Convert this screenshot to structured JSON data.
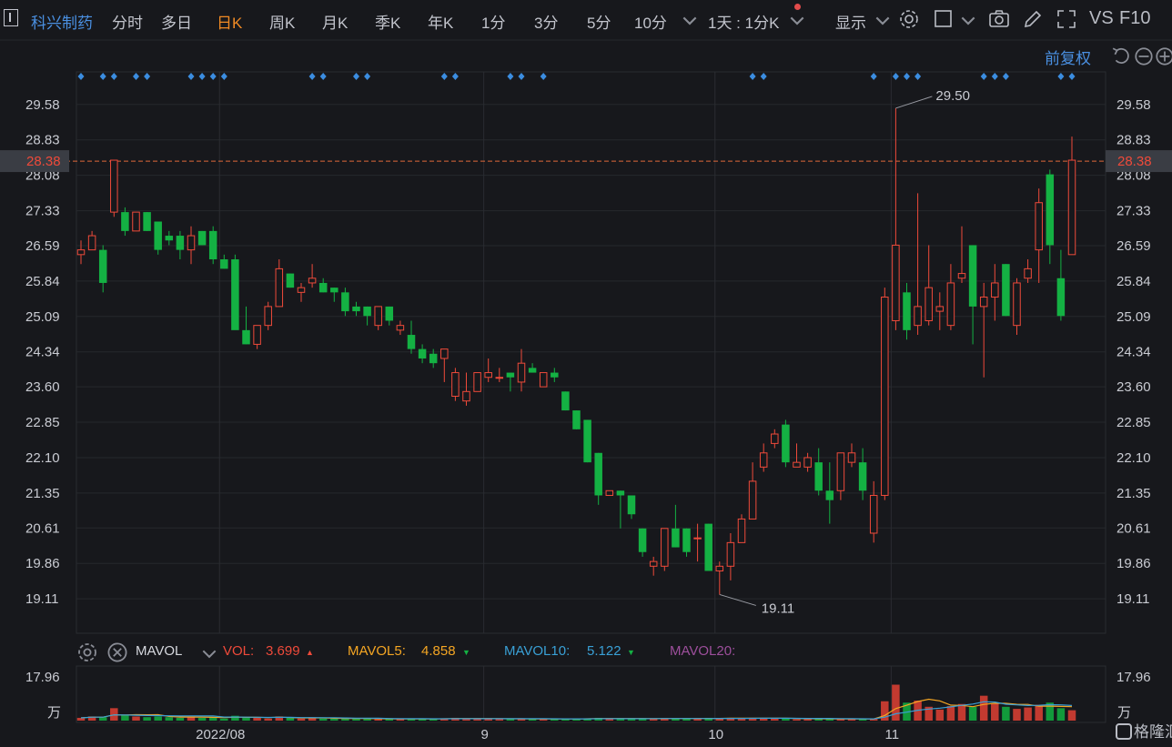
{
  "toolbar": {
    "stock_name": "科兴制药",
    "tabs": [
      "分时",
      "多日",
      "日K",
      "周K",
      "月K",
      "季K",
      "年K",
      "1分",
      "3分",
      "5分",
      "10分"
    ],
    "active_tab": "日K",
    "interval_select": "1天 : 1分K",
    "display_label": "显示",
    "vs_label": "VS",
    "f10_label": "F10",
    "adjust_label": "前复权"
  },
  "chart_data": {
    "type": "candlestick",
    "price_ticks": [
      "29.58",
      "28.83",
      "28.08",
      "27.33",
      "26.59",
      "25.84",
      "25.09",
      "24.34",
      "23.60",
      "22.85",
      "22.10",
      "21.35",
      "20.61",
      "19.86",
      "19.11"
    ],
    "ylim": [
      18.38,
      30.27
    ],
    "current_price": "28.38",
    "high_label": "29.50",
    "low_label": "19.11",
    "date_labels": [
      "2022/08",
      "9",
      "10",
      "11"
    ],
    "candles": [
      {
        "o": 26.4,
        "h": 26.7,
        "l": 26.2,
        "c": 26.5
      },
      {
        "o": 26.5,
        "h": 26.9,
        "l": 26.5,
        "c": 26.8
      },
      {
        "o": 26.5,
        "h": 26.6,
        "l": 25.6,
        "c": 25.8
      },
      {
        "o": 27.3,
        "h": 28.4,
        "l": 27.2,
        "c": 28.4
      },
      {
        "o": 27.3,
        "h": 27.4,
        "l": 26.8,
        "c": 26.9
      },
      {
        "o": 26.9,
        "h": 27.3,
        "l": 26.9,
        "c": 27.3
      },
      {
        "o": 27.3,
        "h": 27.3,
        "l": 26.9,
        "c": 26.9
      },
      {
        "o": 27.1,
        "h": 27.1,
        "l": 26.4,
        "c": 26.5
      },
      {
        "o": 26.8,
        "h": 26.9,
        "l": 26.6,
        "c": 26.7
      },
      {
        "o": 26.8,
        "h": 26.9,
        "l": 26.3,
        "c": 26.5
      },
      {
        "o": 26.5,
        "h": 27.0,
        "l": 26.2,
        "c": 26.8
      },
      {
        "o": 26.9,
        "h": 26.9,
        "l": 26.6,
        "c": 26.6
      },
      {
        "o": 26.9,
        "h": 27.0,
        "l": 26.2,
        "c": 26.3
      },
      {
        "o": 26.3,
        "h": 26.4,
        "l": 26.1,
        "c": 26.1
      },
      {
        "o": 26.3,
        "h": 26.4,
        "l": 24.9,
        "c": 24.8
      },
      {
        "o": 24.8,
        "h": 25.3,
        "l": 24.5,
        "c": 24.5
      },
      {
        "o": 24.5,
        "h": 24.9,
        "l": 24.4,
        "c": 24.9
      },
      {
        "o": 24.9,
        "h": 25.4,
        "l": 24.8,
        "c": 25.3
      },
      {
        "o": 25.3,
        "h": 26.3,
        "l": 25.3,
        "c": 26.1
      },
      {
        "o": 26.0,
        "h": 26.0,
        "l": 25.7,
        "c": 25.7
      },
      {
        "o": 25.6,
        "h": 25.8,
        "l": 25.4,
        "c": 25.7
      },
      {
        "o": 25.8,
        "h": 26.2,
        "l": 25.7,
        "c": 25.9
      },
      {
        "o": 25.8,
        "h": 25.9,
        "l": 25.6,
        "c": 25.6
      },
      {
        "o": 25.7,
        "h": 25.7,
        "l": 25.4,
        "c": 25.6
      },
      {
        "o": 25.6,
        "h": 25.7,
        "l": 25.1,
        "c": 25.2
      },
      {
        "o": 25.3,
        "h": 25.4,
        "l": 25.1,
        "c": 25.2
      },
      {
        "o": 25.3,
        "h": 25.3,
        "l": 24.9,
        "c": 25.1
      },
      {
        "o": 24.9,
        "h": 25.3,
        "l": 24.8,
        "c": 25.3
      },
      {
        "o": 25.3,
        "h": 25.3,
        "l": 24.9,
        "c": 25.0
      },
      {
        "o": 24.8,
        "h": 25.0,
        "l": 24.7,
        "c": 24.9
      },
      {
        "o": 24.7,
        "h": 25.0,
        "l": 24.3,
        "c": 24.4
      },
      {
        "o": 24.4,
        "h": 24.5,
        "l": 24.1,
        "c": 24.2
      },
      {
        "o": 24.3,
        "h": 24.4,
        "l": 24.0,
        "c": 24.1
      },
      {
        "o": 24.2,
        "h": 24.4,
        "l": 23.7,
        "c": 24.4
      },
      {
        "o": 23.4,
        "h": 24.0,
        "l": 23.3,
        "c": 23.9
      },
      {
        "o": 23.3,
        "h": 23.9,
        "l": 23.2,
        "c": 23.5
      },
      {
        "o": 23.5,
        "h": 23.9,
        "l": 23.5,
        "c": 23.9
      },
      {
        "o": 23.8,
        "h": 24.2,
        "l": 23.7,
        "c": 23.9
      },
      {
        "o": 23.8,
        "h": 24.0,
        "l": 23.7,
        "c": 23.8
      },
      {
        "o": 23.9,
        "h": 23.9,
        "l": 23.5,
        "c": 23.8
      },
      {
        "o": 23.7,
        "h": 24.4,
        "l": 23.5,
        "c": 24.1
      },
      {
        "o": 24.0,
        "h": 24.1,
        "l": 23.9,
        "c": 23.9
      },
      {
        "o": 23.6,
        "h": 23.9,
        "l": 23.6,
        "c": 23.9
      },
      {
        "o": 23.9,
        "h": 24.0,
        "l": 23.7,
        "c": 23.8
      },
      {
        "o": 23.5,
        "h": 23.5,
        "l": 23.1,
        "c": 23.1
      },
      {
        "o": 23.1,
        "h": 23.1,
        "l": 22.7,
        "c": 22.7
      },
      {
        "o": 22.9,
        "h": 22.9,
        "l": 22.0,
        "c": 22.0
      },
      {
        "o": 22.2,
        "h": 22.2,
        "l": 21.1,
        "c": 21.3
      },
      {
        "o": 21.3,
        "h": 21.4,
        "l": 21.3,
        "c": 21.4
      },
      {
        "o": 21.4,
        "h": 21.4,
        "l": 20.6,
        "c": 21.3
      },
      {
        "o": 21.3,
        "h": 21.3,
        "l": 20.8,
        "c": 20.9
      },
      {
        "o": 20.6,
        "h": 20.6,
        "l": 20.0,
        "c": 20.1
      },
      {
        "o": 19.8,
        "h": 20.0,
        "l": 19.6,
        "c": 19.9
      },
      {
        "o": 19.8,
        "h": 20.6,
        "l": 19.7,
        "c": 20.6
      },
      {
        "o": 20.6,
        "h": 21.1,
        "l": 20.2,
        "c": 20.2
      },
      {
        "o": 20.6,
        "h": 20.6,
        "l": 20.0,
        "c": 20.1
      },
      {
        "o": 20.4,
        "h": 20.7,
        "l": 19.9,
        "c": 20.4
      },
      {
        "o": 20.7,
        "h": 20.7,
        "l": 19.7,
        "c": 19.7
      },
      {
        "o": 19.7,
        "h": 19.9,
        "l": 19.2,
        "c": 19.8
      },
      {
        "o": 19.8,
        "h": 20.5,
        "l": 19.5,
        "c": 20.3
      },
      {
        "o": 20.3,
        "h": 20.9,
        "l": 20.3,
        "c": 20.8
      },
      {
        "o": 20.8,
        "h": 22.0,
        "l": 20.8,
        "c": 21.6
      },
      {
        "o": 21.9,
        "h": 22.4,
        "l": 21.8,
        "c": 22.2
      },
      {
        "o": 22.4,
        "h": 22.7,
        "l": 22.3,
        "c": 22.6
      },
      {
        "o": 22.8,
        "h": 22.9,
        "l": 21.9,
        "c": 22.0
      },
      {
        "o": 21.9,
        "h": 22.4,
        "l": 21.9,
        "c": 22.0
      },
      {
        "o": 21.9,
        "h": 22.2,
        "l": 21.8,
        "c": 22.1
      },
      {
        "o": 22.0,
        "h": 22.3,
        "l": 21.3,
        "c": 21.4
      },
      {
        "o": 21.4,
        "h": 22.0,
        "l": 20.7,
        "c": 21.2
      },
      {
        "o": 21.4,
        "h": 22.2,
        "l": 21.2,
        "c": 22.2
      },
      {
        "o": 22.0,
        "h": 22.4,
        "l": 21.9,
        "c": 22.2
      },
      {
        "o": 22.0,
        "h": 22.3,
        "l": 21.2,
        "c": 21.4
      },
      {
        "o": 20.5,
        "h": 21.6,
        "l": 20.3,
        "c": 21.3
      },
      {
        "o": 21.3,
        "h": 25.7,
        "l": 21.2,
        "c": 25.5
      },
      {
        "o": 25.0,
        "h": 29.5,
        "l": 24.8,
        "c": 26.6
      },
      {
        "o": 25.6,
        "h": 25.8,
        "l": 24.6,
        "c": 24.8
      },
      {
        "o": 24.9,
        "h": 27.7,
        "l": 24.7,
        "c": 25.3
      },
      {
        "o": 25.0,
        "h": 26.6,
        "l": 24.9,
        "c": 25.7
      },
      {
        "o": 25.2,
        "h": 25.6,
        "l": 24.8,
        "c": 25.3
      },
      {
        "o": 24.9,
        "h": 26.2,
        "l": 24.8,
        "c": 25.8
      },
      {
        "o": 25.9,
        "h": 27.0,
        "l": 25.8,
        "c": 26.0
      },
      {
        "o": 26.6,
        "h": 26.6,
        "l": 24.5,
        "c": 25.3
      },
      {
        "o": 25.3,
        "h": 25.8,
        "l": 23.8,
        "c": 25.5
      },
      {
        "o": 25.5,
        "h": 26.2,
        "l": 25.0,
        "c": 25.8
      },
      {
        "o": 26.2,
        "h": 26.2,
        "l": 25.1,
        "c": 25.1
      },
      {
        "o": 24.9,
        "h": 25.9,
        "l": 24.7,
        "c": 25.8
      },
      {
        "o": 25.9,
        "h": 26.3,
        "l": 25.8,
        "c": 26.1
      },
      {
        "o": 26.5,
        "h": 27.8,
        "l": 25.8,
        "c": 27.5
      },
      {
        "o": 28.1,
        "h": 28.2,
        "l": 26.2,
        "c": 26.6
      },
      {
        "o": 25.9,
        "h": 26.5,
        "l": 25.0,
        "c": 25.1
      },
      {
        "o": 26.4,
        "h": 28.9,
        "l": 26.4,
        "c": 28.4
      }
    ],
    "markers": [
      0,
      2,
      3,
      5,
      6,
      10,
      11,
      12,
      13,
      21,
      22,
      25,
      26,
      33,
      34,
      39,
      40,
      42,
      61,
      62,
      72,
      74,
      75,
      76,
      82,
      83,
      84,
      89,
      90
    ],
    "volumes": [
      0.4,
      0.6,
      0.5,
      1.8,
      0.8,
      0.6,
      0.5,
      0.6,
      0.5,
      0.4,
      0.6,
      0.4,
      0.5,
      0.3,
      0.7,
      0.5,
      0.4,
      0.3,
      0.6,
      0.4,
      0.3,
      0.4,
      0.3,
      0.3,
      0.3,
      0.3,
      0.3,
      0.2,
      0.2,
      0.2,
      0.3,
      0.3,
      0.2,
      0.3,
      0.4,
      0.3,
      0.3,
      0.2,
      0.2,
      0.3,
      0.3,
      0.2,
      0.2,
      0.2,
      0.3,
      0.3,
      0.3,
      0.4,
      0.2,
      0.3,
      0.3,
      0.3,
      0.3,
      0.3,
      0.3,
      0.3,
      0.3,
      0.4,
      0.3,
      0.4,
      0.3,
      0.4,
      0.4,
      0.3,
      0.3,
      0.2,
      0.2,
      0.3,
      0.3,
      0.2,
      0.2,
      0.2,
      0.3,
      2.8,
      5.2,
      2.6,
      2.9,
      2.0,
      1.6,
      2.1,
      2.4,
      2.0,
      3.6,
      2.5,
      2.0,
      1.7,
      1.9,
      2.3,
      2.6,
      1.8,
      1.5
    ],
    "vol_ticks": [
      "17.96",
      "万"
    ],
    "vol_max": 17.96
  },
  "indicators": {
    "name": "MAVOL",
    "vol_label": "VOL:",
    "vol_value": "3.699",
    "mavol5_label": "MAVOL5:",
    "mavol5_value": "4.858",
    "mavol10_label": "MAVOL10:",
    "mavol10_value": "5.122",
    "mavol20_label": "MAVOL20:"
  },
  "colors": {
    "up": "#ef4a3a",
    "down": "#14b143",
    "name": "#4a90e2",
    "active_tab": "#f08a24",
    "mavol5": "#f5a623",
    "mavol10": "#39a0d6",
    "mavol20": "#9d4f9c"
  },
  "watermark": "格隆汇"
}
